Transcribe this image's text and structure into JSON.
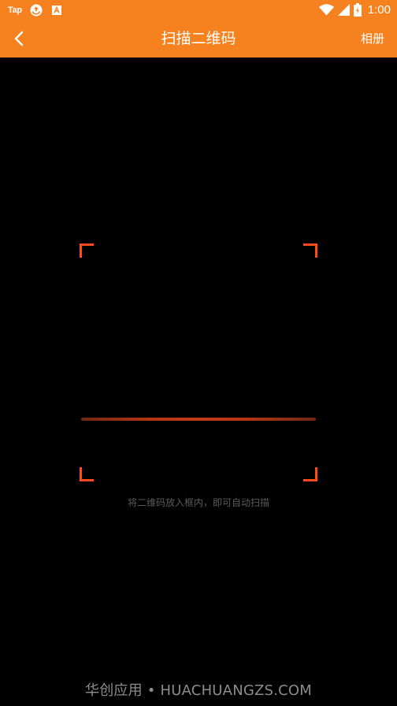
{
  "status_bar": {
    "app_badge": "Tap",
    "time": "1:00",
    "background": "#F5821F",
    "icons": [
      "tap-icon",
      "sync-icon",
      "a-badge-icon",
      "wifi-icon",
      "signal-icon",
      "battery-icon"
    ]
  },
  "title_bar": {
    "back_icon": "chevron-left-icon",
    "title": "扫描二维码",
    "album_label": "相册",
    "background": "#F5821F"
  },
  "scanner": {
    "corner_color": "#FF4A1A",
    "line_color": "#C23A15",
    "hint": "将二维码放入框内，即可自动扫描"
  },
  "watermark": {
    "text": "华创应用 • HUACHUANGZS.COM"
  }
}
